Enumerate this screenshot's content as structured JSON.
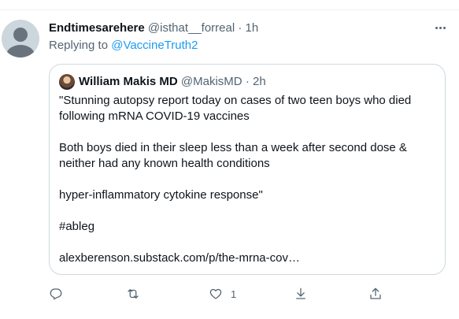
{
  "tweet": {
    "display_name": "Endtimesarehere",
    "handle": "@isthat__forreal",
    "separator": "·",
    "time": "1h",
    "replying_prefix": "Replying to ",
    "replying_to": "@VaccineTruth2"
  },
  "quote": {
    "display_name": "William Makis MD",
    "handle": "@MakisMD",
    "separator": "·",
    "time": "2h",
    "lines": [
      "\"Stunning autopsy report today on cases of two teen boys who died",
      "following mRNA COVID-19 vaccines",
      "",
      "Both boys died in their sleep less than a week after second dose &",
      "neither had any known health conditions",
      "",
      "hyper-inflammatory cytokine response\"",
      "",
      "#ableg",
      "",
      "alexberenson.substack.com/p/the-mrna-cov…"
    ]
  },
  "actions": {
    "reply_icon": "reply-icon",
    "retweet_icon": "retweet-icon",
    "like_icon": "heart-icon",
    "like_count": "1",
    "download_icon": "download-icon",
    "share_icon": "share-icon"
  },
  "colors": {
    "accent": "#1d9bf0",
    "muted": "#536471",
    "border": "#cfd9de"
  }
}
